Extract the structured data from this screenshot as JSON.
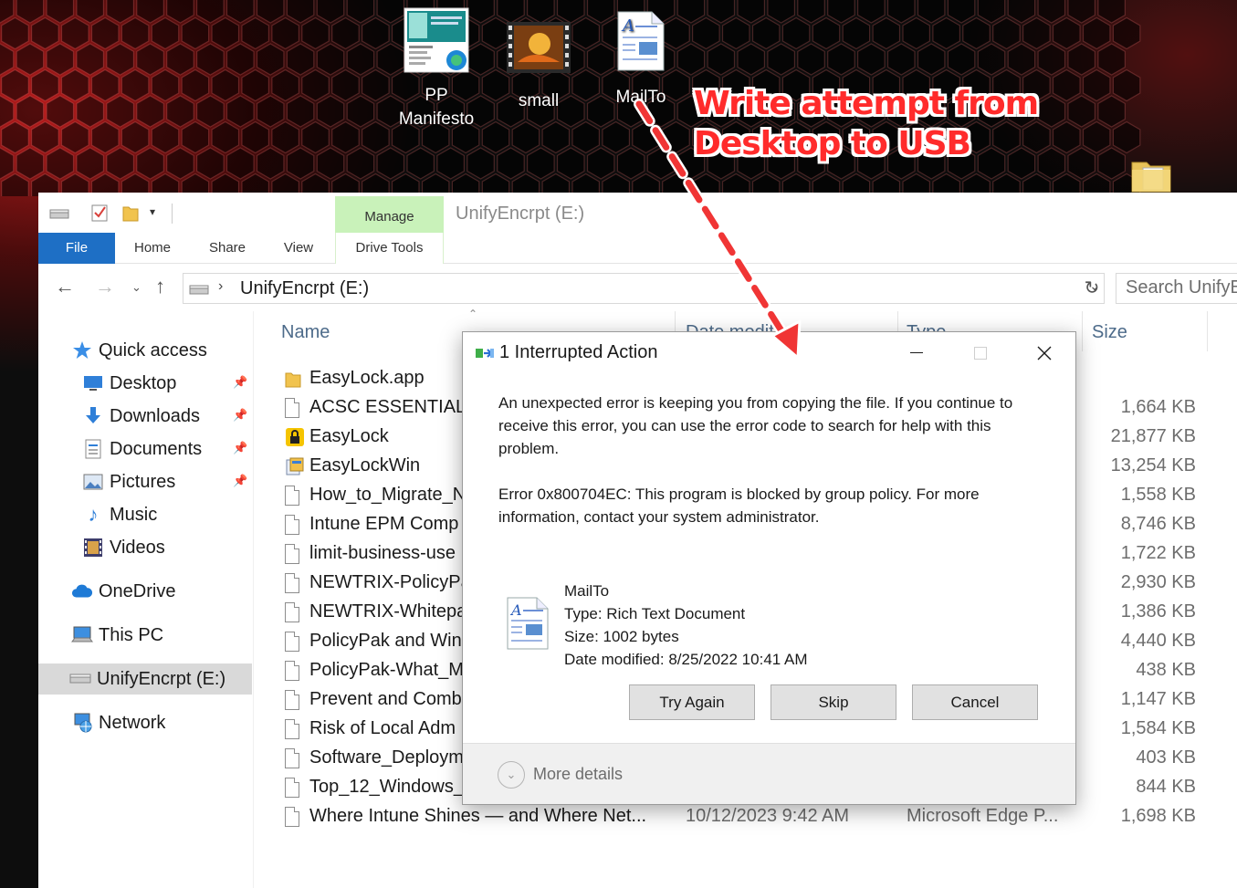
{
  "desktop": {
    "icons": [
      {
        "label_line1": "PP",
        "label_line2": "Manifesto",
        "icon": "pdf-thumbnail-icon"
      },
      {
        "label": "small",
        "icon": "video-thumbnail-icon"
      },
      {
        "label": "MailTo",
        "icon": "rich-text-document-icon"
      }
    ],
    "annotation": {
      "line1": "Write attempt from",
      "line2": "Desktop to USB",
      "color": "#ff2b2b"
    }
  },
  "explorer": {
    "window_title": "UnifyEncrpt (E:)",
    "contextual_tab_group": "Manage",
    "ribbon_tabs": [
      "File",
      "Home",
      "Share",
      "View",
      "Drive Tools"
    ],
    "address": {
      "path": "UnifyEncrpt (E:)",
      "drive_icon": "usb-drive-icon"
    },
    "search_placeholder": "Search UnifyE",
    "nav_pane": {
      "quick_access": "Quick access",
      "items": [
        {
          "label": "Desktop",
          "icon": "desktop-icon",
          "pinned": true
        },
        {
          "label": "Downloads",
          "icon": "downloads-icon",
          "pinned": true
        },
        {
          "label": "Documents",
          "icon": "documents-icon",
          "pinned": true
        },
        {
          "label": "Pictures",
          "icon": "pictures-icon",
          "pinned": true
        },
        {
          "label": "Music",
          "icon": "music-icon",
          "pinned": false
        },
        {
          "label": "Videos",
          "icon": "videos-icon",
          "pinned": false
        }
      ],
      "onedrive": "OneDrive",
      "this_pc": "This PC",
      "drive": "UnifyEncrpt (E:)",
      "network": "Network"
    },
    "columns": {
      "name": "Name",
      "date": "Date modified",
      "type": "Type",
      "size": "Size"
    },
    "files": [
      {
        "name": "EasyLock.app",
        "icon": "folder-icon",
        "size": ""
      },
      {
        "name": "ACSC ESSENTIAL I",
        "icon": "file-icon",
        "size": "1,664 KB"
      },
      {
        "name": "EasyLock",
        "icon": "lock-app-icon",
        "size": "21,877 KB"
      },
      {
        "name": "EasyLockWin",
        "icon": "installer-icon",
        "size": "13,254 KB"
      },
      {
        "name": "How_to_Migrate_N",
        "icon": "file-icon",
        "size": "1,558 KB"
      },
      {
        "name": "Intune EPM Comp",
        "icon": "file-icon",
        "size": "8,746 KB"
      },
      {
        "name": "limit-business-use",
        "icon": "file-icon",
        "size": "1,722 KB"
      },
      {
        "name": "NEWTRIX-PolicyPa",
        "icon": "file-icon",
        "size": "2,930 KB"
      },
      {
        "name": "NEWTRIX-Whitepa",
        "icon": "file-icon",
        "size": "1,386 KB"
      },
      {
        "name": "PolicyPak and Win",
        "icon": "file-icon",
        "size": "4,440 KB"
      },
      {
        "name": "PolicyPak-What_M",
        "icon": "file-icon",
        "size": "438 KB"
      },
      {
        "name": "Prevent and Comb",
        "icon": "file-icon",
        "size": "1,147 KB"
      },
      {
        "name": "Risk of Local Adm",
        "icon": "file-icon",
        "size": "1,584 KB"
      },
      {
        "name": "Software_Deploym",
        "icon": "file-icon",
        "size": "403 KB"
      },
      {
        "name": "Top_12_Windows_",
        "icon": "file-icon",
        "size": "844 KB"
      },
      {
        "name": "Where Intune Shines — and Where Net...",
        "icon": "file-icon",
        "date": "10/12/2023 9:42 AM",
        "type": "Microsoft Edge P...",
        "size": "1,698 KB"
      }
    ]
  },
  "dialog": {
    "title": "1 Interrupted Action",
    "message": "An unexpected error is keeping you from copying the file. If you continue to receive this error, you can use the error code to search for help with this problem.",
    "error": "Error 0x800704EC: This program is blocked by group policy. For more information, contact your system administrator.",
    "file": {
      "name": "MailTo",
      "type": "Type: Rich Text Document",
      "size": "Size: 1002 bytes",
      "modified": "Date modified: 8/25/2022 10:41 AM"
    },
    "buttons": {
      "try_again": "Try Again",
      "skip": "Skip",
      "cancel": "Cancel"
    },
    "more_details": "More details"
  }
}
